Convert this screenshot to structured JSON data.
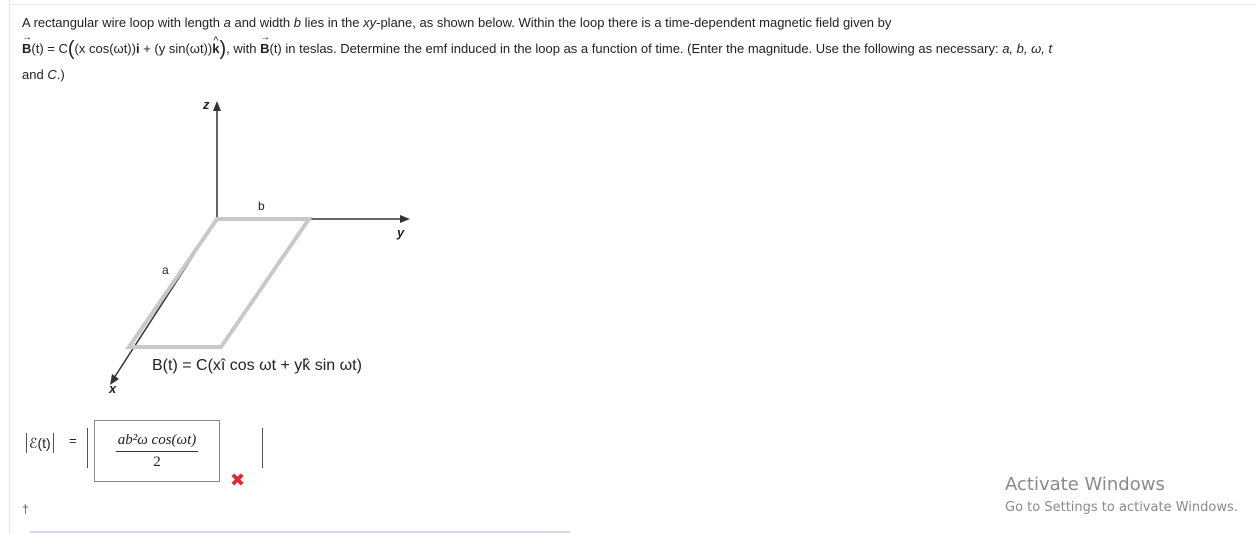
{
  "question": {
    "intro": "A rectangular wire loop with length ",
    "var_a": "a",
    "and_width": " and width ",
    "var_b": "b",
    "lies_in": " lies in the ",
    "plane_xy": "xy",
    "plane_rest": "-plane, as shown below. Within the loop there is a time-dependent magnetic field given by",
    "field_B": "B",
    "field_lhs_rest": "(t) = C",
    "field_x_term": "(x cos(ωt))",
    "field_i_hat": "i",
    "field_plus": " + (y sin(ωt))",
    "field_k_hat": "k",
    "with_text": ", with ",
    "with_B": "B",
    "with_rest": "(t) in teslas. Determine the emf induced in the loop as a function of time. (Enter the magnitude. Use the following as necessary: ",
    "vars_list": "a, b, ω, t",
    "line3": "and ",
    "var_C": "C",
    "line3_end": ".)"
  },
  "figure": {
    "axis_z": "z",
    "axis_y": "y",
    "axis_x": "x",
    "label_a": "a",
    "label_b": "b",
    "field_equation": "B(t) = C(xî cos ωt + yk̂ sin ωt)"
  },
  "answer": {
    "label": "ℰ(t)",
    "equals": "=",
    "numerator": "ab²ω cos(ωt)",
    "denominator": "2",
    "status": "incorrect",
    "status_icon": "✖"
  },
  "footer": {
    "dagger": "†"
  },
  "watermark": {
    "title": "Activate Windows",
    "subtitle": "Go to Settings to activate Windows."
  },
  "colors": {
    "wrong": "#e0282f",
    "watermark": "#8a8a8a",
    "loop": "#c8c8c8"
  }
}
